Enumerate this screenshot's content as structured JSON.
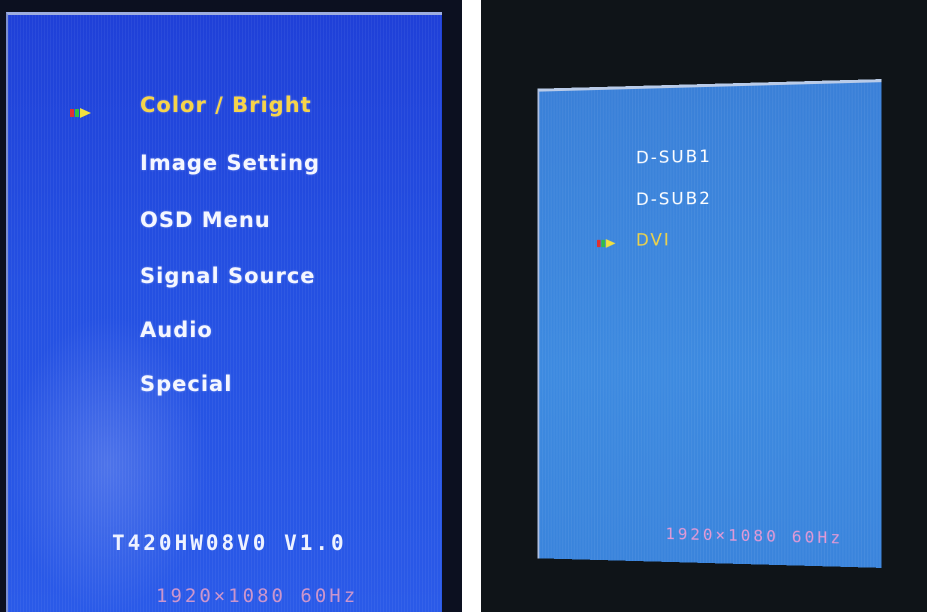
{
  "left_osd": {
    "menu_items": [
      {
        "label": "Color / Bright",
        "selected": true
      },
      {
        "label": "Image  Setting",
        "selected": false
      },
      {
        "label": "OSD  Menu",
        "selected": false
      },
      {
        "label": "Signal  Source",
        "selected": false
      },
      {
        "label": "Audio",
        "selected": false
      },
      {
        "label": "Special",
        "selected": false
      }
    ],
    "model": "T420HW08V0  V1.0",
    "resolution": "1920×1080  60Hz"
  },
  "right_osd": {
    "source_items": [
      {
        "label": "D-SUB1",
        "selected": false
      },
      {
        "label": "D-SUB2",
        "selected": false
      },
      {
        "label": "DVI",
        "selected": true
      }
    ],
    "resolution": "1920×1080  60Hz"
  },
  "colors": {
    "osd_background": "#2450e2",
    "selected_text": "#f6d44a",
    "normal_text": "#f4f6ff",
    "resolution_text": "#e8a0c8"
  },
  "icons": {
    "selection_pointer": "pointer-arrow-icon"
  }
}
